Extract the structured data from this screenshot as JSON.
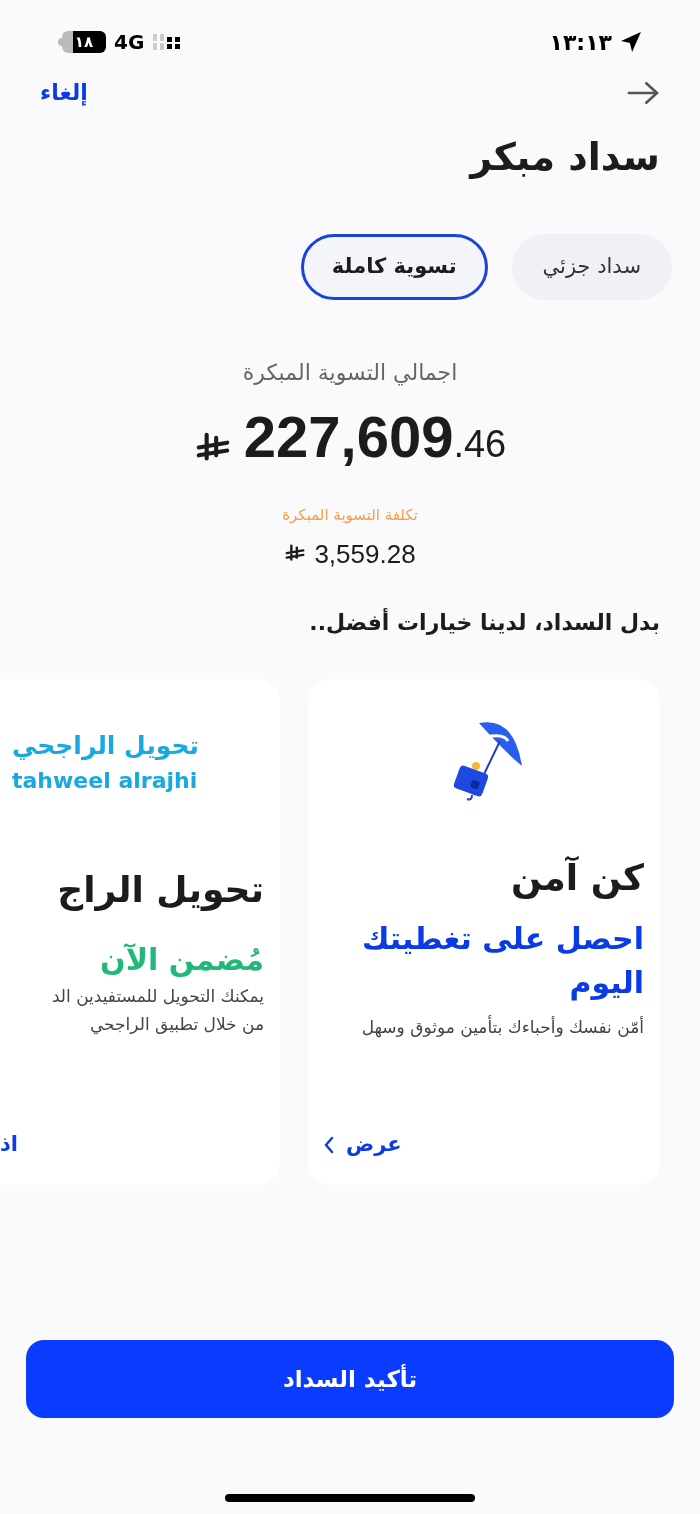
{
  "status_bar": {
    "time": "١٣:١٣",
    "battery": "١٨",
    "network": "4G"
  },
  "nav": {
    "cancel": "إلغاء"
  },
  "title": "سداد مبكر",
  "tabs": [
    {
      "label": "سداد جزئي",
      "selected": false
    },
    {
      "label": "تسوية كاملة",
      "selected": true
    }
  ],
  "total": {
    "label": "اجمالي التسوية المبكرة",
    "integer": "227,609",
    "fraction": ".46"
  },
  "cost": {
    "label": "تكلفة التسوية المبكرة",
    "value": "3,559.28"
  },
  "section_title": "بدل السداد، لدينا خيارات أفضل..",
  "cards": [
    {
      "kind": "insurance",
      "title": "كن آمن",
      "subtitle": "احصل على تغطيتك اليوم",
      "description": "أمّن نفسك وأحباءك بتأمين موثوق وسهل",
      "link": "عرض"
    },
    {
      "kind": "transfer",
      "logo_arabic": "تحويل الراجحي",
      "logo_latin": "tahweel alrajhi",
      "title": "تحويل الراج",
      "subtitle": "مُضمن الآن",
      "description_lines": [
        "يمكنك التحويل للمستفيدين الد",
        "من خلال تطبيق الراجحي"
      ],
      "link": "اذ"
    }
  ],
  "confirm_button": "تأكيد السداد"
}
